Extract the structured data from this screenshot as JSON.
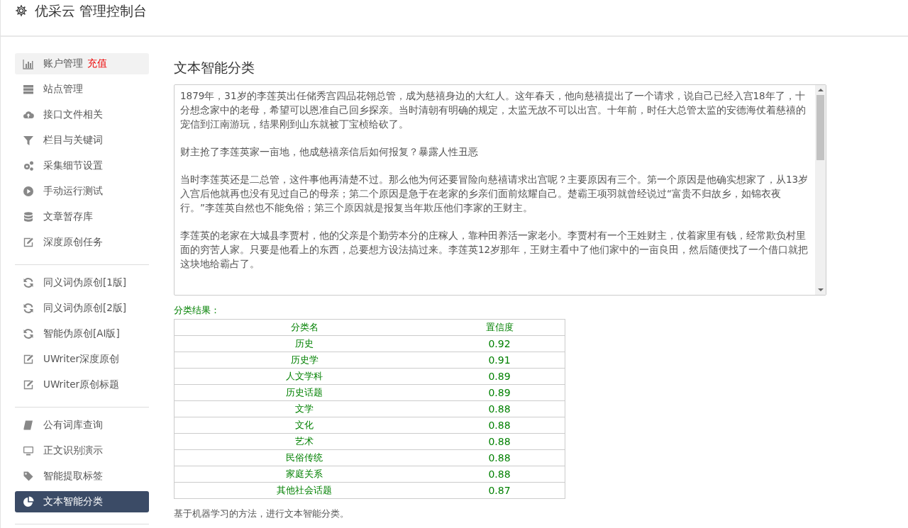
{
  "header": {
    "title": "优采云 管理控制台"
  },
  "sidebar": {
    "groups": [
      [
        {
          "label": "账户管理",
          "badge": "充值",
          "kind": "chart",
          "selected": false,
          "highlighted": true
        },
        {
          "label": "站点管理",
          "kind": "server",
          "selected": false,
          "highlighted": false
        },
        {
          "label": "接口文件相关",
          "kind": "cloud",
          "selected": false,
          "highlighted": false
        },
        {
          "label": "栏目与关键词",
          "kind": "filter",
          "selected": false,
          "highlighted": false
        },
        {
          "label": "采集细节设置",
          "kind": "gears",
          "selected": false,
          "highlighted": false
        },
        {
          "label": "手动运行测试",
          "kind": "play",
          "selected": false,
          "highlighted": false
        },
        {
          "label": "文章暂存库",
          "kind": "database",
          "selected": false,
          "highlighted": false
        },
        {
          "label": "深度原创任务",
          "kind": "edit",
          "selected": false,
          "highlighted": false
        }
      ],
      [
        {
          "label": "同义词伪原创[1版]",
          "kind": "refresh",
          "selected": false,
          "highlighted": false
        },
        {
          "label": "同义词伪原创[2版]",
          "kind": "refresh",
          "selected": false,
          "highlighted": false
        },
        {
          "label": "智能伪原创[AI版]",
          "kind": "refresh",
          "selected": false,
          "highlighted": false
        },
        {
          "label": "UWriter深度原创",
          "kind": "edit",
          "selected": false,
          "highlighted": false
        },
        {
          "label": "UWriter原创标题",
          "kind": "edit",
          "selected": false,
          "highlighted": false
        }
      ],
      [
        {
          "label": "公有词库查询",
          "kind": "book",
          "selected": false,
          "highlighted": false
        },
        {
          "label": "正文识别演示",
          "kind": "monitor",
          "selected": false,
          "highlighted": false
        },
        {
          "label": "智能提取标签",
          "kind": "tag",
          "selected": false,
          "highlighted": false
        },
        {
          "label": "文本智能分类",
          "kind": "pie",
          "selected": true,
          "highlighted": false
        }
      ]
    ]
  },
  "main": {
    "title": "文本智能分类",
    "text_input": {
      "paragraphs": [
        "1879年，31岁的李莲英出任储秀宫四品花翎总管，成为慈禧身边的大红人。这年春天，他向慈禧提出了一个请求，说自己已经入宫18年了，十分想念家中的老母，希望可以恩准自己回乡探亲。当时清朝有明确的规定，太监无故不可以出宫。十年前，时任大总管太监的安德海仗着慈禧的宠信到江南游玩，结果刚到山东就被丁宝桢给砍了。",
        "财主抢了李莲英家一亩地，他成慈禧亲信后如何报复？暴露人性丑恶",
        "当时李莲英还是二总管，这件事他再清楚不过。那么他为何还要冒险向慈禧请求出宫呢？主要原因有三个。第一个原因是他确实想家了，从13岁入宫后他就再也没有见过自己的母亲；第二个原因是急于在老家的乡亲们面前炫耀自己。楚霸王项羽就曾经说过“富贵不归故乡，如锦衣夜行。”李莲英自然也不能免俗；第三个原因就是报复当年欺压他们李家的王财主。",
        "李莲英的老家在大城县李贾村，他的父亲是个勤劳本分的庄稼人，靠种田养活一家老小。李贾村有一个王姓财主，仗着家里有钱，经常欺负村里面的穷苦人家。只要是他看上的东西，总要想方设法搞过来。李莲英12岁那年，王财主看中了他们家中的一亩良田，然后随便找了一个借口就把这块地给霸占了。"
      ]
    },
    "result_label": "分类结果：",
    "table": {
      "columns": [
        "分类名",
        "置信度"
      ],
      "rows": [
        [
          "历史",
          "0.92"
        ],
        [
          "历史学",
          "0.91"
        ],
        [
          "人文学科",
          "0.89"
        ],
        [
          "历史话题",
          "0.89"
        ],
        [
          "文学",
          "0.88"
        ],
        [
          "文化",
          "0.88"
        ],
        [
          "艺术",
          "0.88"
        ],
        [
          "民俗传统",
          "0.88"
        ],
        [
          "家庭关系",
          "0.88"
        ],
        [
          "其他社会话题",
          "0.87"
        ]
      ]
    },
    "footnote": "基于机器学习的方法，进行文本智能分类。"
  }
}
